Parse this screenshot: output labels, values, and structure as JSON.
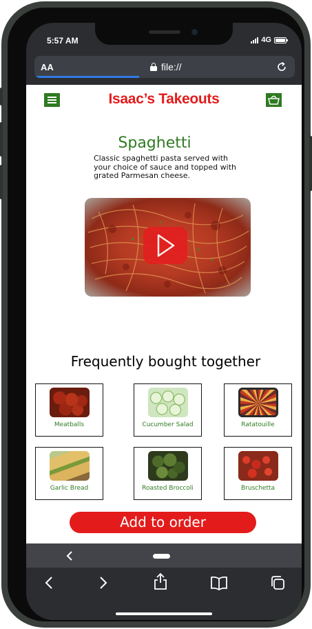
{
  "status_bar": {
    "time": "5:57 AM",
    "network": "4G"
  },
  "browser": {
    "text_size_button": "AA",
    "url": "file://",
    "reload_icon": "reload-icon",
    "lock_icon": "lock-icon"
  },
  "site": {
    "brand": "Isaac’s Takeouts",
    "brand_color": "#e41b1b",
    "accent_color": "#2f7a22",
    "menu_icon": "menu-icon",
    "cart_icon": "basket-icon"
  },
  "dish": {
    "title": "Spaghetti",
    "description": "Classic spaghetti pasta served with your choice of sauce and topped with grated Parmesan cheese.",
    "video_play_icon": "play-icon"
  },
  "related": {
    "heading": "Frequently bought together",
    "items": [
      {
        "name": "Meatballs"
      },
      {
        "name": "Cucumber Salad"
      },
      {
        "name": "Ratatouille"
      },
      {
        "name": "Garlic Bread"
      },
      {
        "name": "Roasted Broccoli"
      },
      {
        "name": "Bruschetta"
      }
    ]
  },
  "cta": {
    "add_to_order": "Add to order"
  },
  "toolbar": {
    "icons": [
      "back-icon",
      "forward-icon",
      "share-icon",
      "bookmarks-icon",
      "tabs-icon"
    ]
  }
}
